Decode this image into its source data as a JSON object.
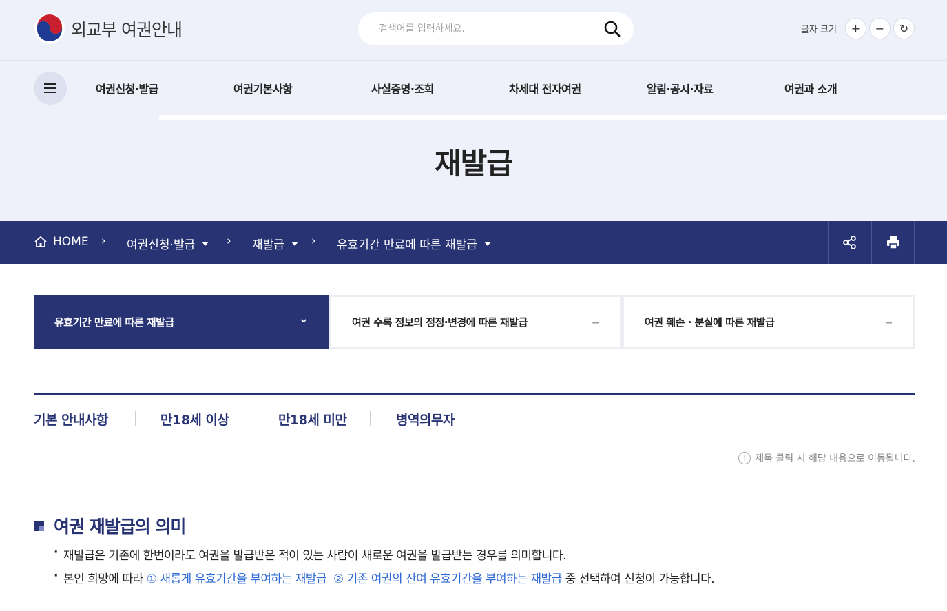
{
  "header": {
    "logo_text": "외교부 여권안내",
    "search_placeholder": "검색어를 입력하세요.",
    "fontsize_label": "글자 크기",
    "fontsize_plus": "+",
    "fontsize_minus": "−",
    "fontsize_reset": "↻"
  },
  "gnb": {
    "items": [
      "여권신청·발급",
      "여권기본사항",
      "사실증명·조회",
      "차세대 전자여권",
      "알림·공시·자료",
      "여권과 소개"
    ]
  },
  "page_title": "재발급",
  "breadcrumb": {
    "home": "HOME",
    "items": [
      "여권신청·발급",
      "재발급",
      "유효기간 만료에 따른 재발급"
    ]
  },
  "tabs": [
    {
      "label": "유효기간 만료에 따른 재발급",
      "icon": "⌄"
    },
    {
      "label": "여권 수록 정보의 정정·변경에 따른 재발급",
      "icon": "−"
    },
    {
      "label": "여권 훼손 · 분실에 따른 재발급",
      "icon": "−"
    }
  ],
  "subtabs": [
    "기본 안내사항",
    "만18세 이상",
    "만18세 미만",
    "병역의무자"
  ],
  "hint": "제목 클릭 시 해당 내용으로 이동됩니다.",
  "section": {
    "title": "여권 재발급의 의미",
    "line1": "재발급은 기존에 한번이라도 여권을 발급받은 적이 있는 사람이 새로운 여권을 발급받는 경우를 의미합니다.",
    "line2_prefix": "본인 희망에 따라 ",
    "line2_hl1": "① 새롭게 유효기간을 부여하는 재발급",
    "line2_hl2": "② 기존 여권의 잔여 유효기간을 부여하는 재발급",
    "line2_suffix": " 중 선택하여 신청이 가능합니다."
  }
}
